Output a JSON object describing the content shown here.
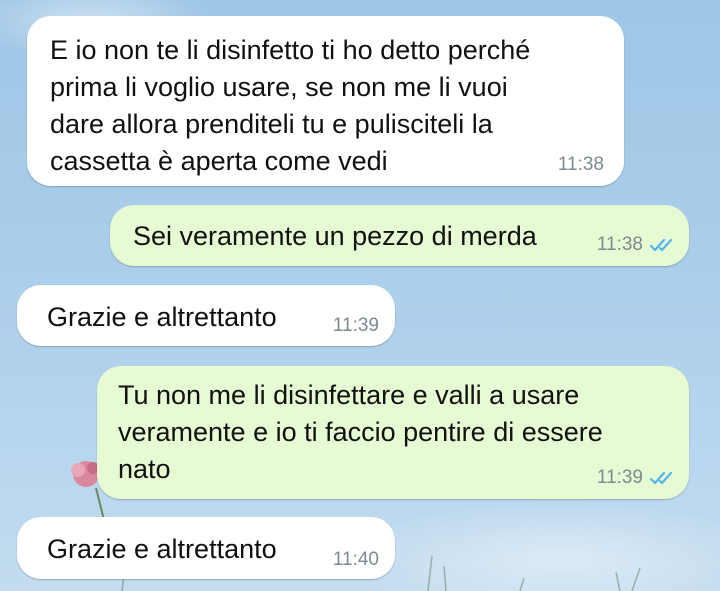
{
  "chat": {
    "messages": [
      {
        "direction": "incoming",
        "text": "E io non te li disinfetto ti ho detto perché\nprima li voglio usare, se non me li vuoi\ndare allora prenditeli tu e pulisciteli la\ncassetta è aperta come vedi",
        "time": "11:38"
      },
      {
        "direction": "outgoing",
        "text": "Sei veramente un pezzo di merda",
        "time": "11:38",
        "status_icon": "double-check-read-icon"
      },
      {
        "direction": "incoming",
        "text": "Grazie e altrettanto",
        "time": "11:39"
      },
      {
        "direction": "outgoing",
        "text": "Tu non me li disinfettare e valli a usare\nveramente e io ti faccio pentire di essere\nnato",
        "time": "11:39",
        "status_icon": "double-check-read-icon"
      },
      {
        "direction": "incoming",
        "text": "Grazie e altrettanto",
        "time": "11:40"
      }
    ]
  },
  "colors": {
    "incoming_bubble": "#ffffff",
    "outgoing_bubble": "#e6fbd3",
    "timestamp": "#7d8a8f",
    "read_ticks": "#4fb6ec",
    "wallpaper_sky": "#a9cdea"
  }
}
